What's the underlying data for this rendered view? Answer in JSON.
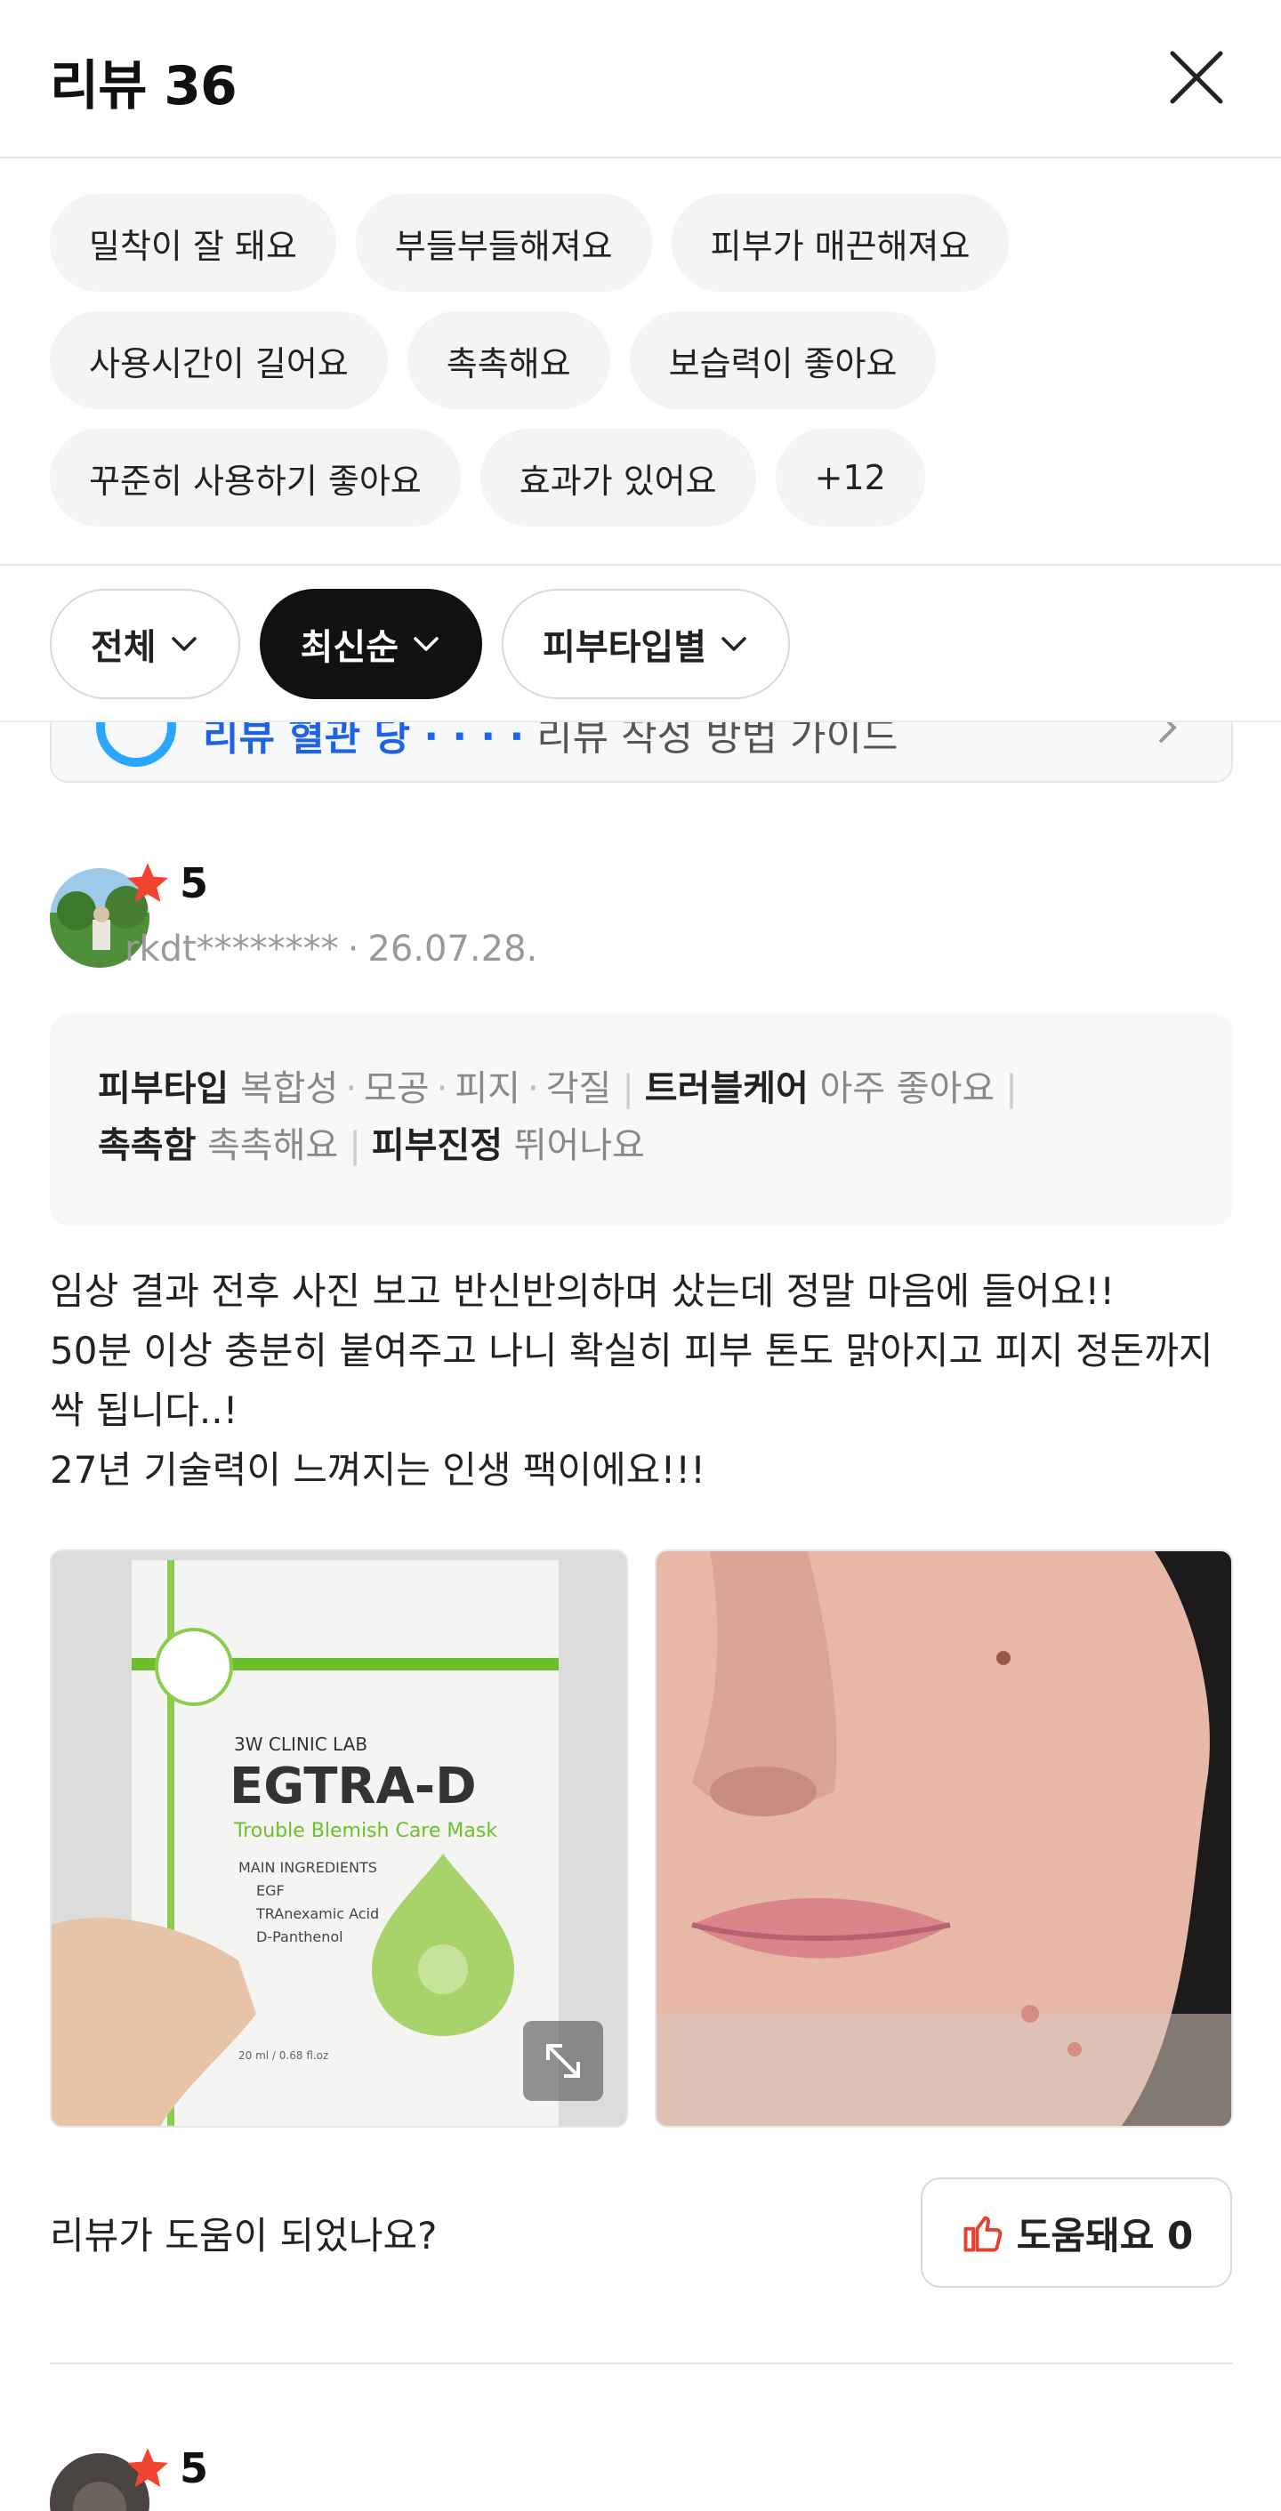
{
  "header": {
    "title": "리뷰 36"
  },
  "keywords": [
    "밀착이 잘 돼요",
    "부들부들해져요",
    "피부가 매끈해져요",
    "사용시간이 길어요",
    "촉촉해요",
    "보습력이 좋아요",
    "꾸준히 사용하기 좋아요",
    "효과가 있어요",
    "+12"
  ],
  "filters": {
    "all": "전체",
    "latest": "최신순",
    "skin_type": "피부타입별"
  },
  "banner": {
    "highlight": "리뷰 혈관 당 ∙ ∙ ∙ ∙",
    "text": "리뷰 작성 방법 가이드"
  },
  "review1": {
    "rating": "5",
    "author": "rkdt********",
    "date": "26.07.28.",
    "skin_label": "피부타입",
    "skin_values": [
      "복합성",
      "모공",
      "피지",
      "각질"
    ],
    "trouble_label": "트러블케어",
    "trouble_value": "아주 좋아요",
    "moist_label": "촉촉함",
    "moist_value": "촉촉해요",
    "calm_label": "피부진정",
    "calm_value": "뛰어나요",
    "body_lines": [
      "임상 결과 전후 사진 보고 반신반의하며 샀는데 정말 마음에 들어요!!",
      "50분 이상 충분히 붙여주고 나니 확실히 피부 톤도 맑아지고 피지 정돈까지",
      "싹 됩니다..!",
      "27년 기술력이 느껴지는 인생 팩이에요!!!"
    ],
    "package": {
      "brand": "3W CLINIC LAB",
      "name": "EGTRA-D",
      "subtitle": "Trouble Blemish Care Mask",
      "ingredients_title": "MAIN INGREDIENTS",
      "ingredients": [
        "EGF",
        "TRAnexamic Acid",
        "D-Panthenol"
      ],
      "volume": "20 ml / 0.68 fl.oz"
    },
    "helpful_question": "리뷰가 도움이 되었나요?",
    "helpful_label": "도움돼요 0"
  },
  "review2": {
    "rating": "5"
  },
  "colors": {
    "star": "#f2442e",
    "thumb": "#e8402e",
    "active_filter": "#111111",
    "chip_bg": "#f2f4f6"
  }
}
